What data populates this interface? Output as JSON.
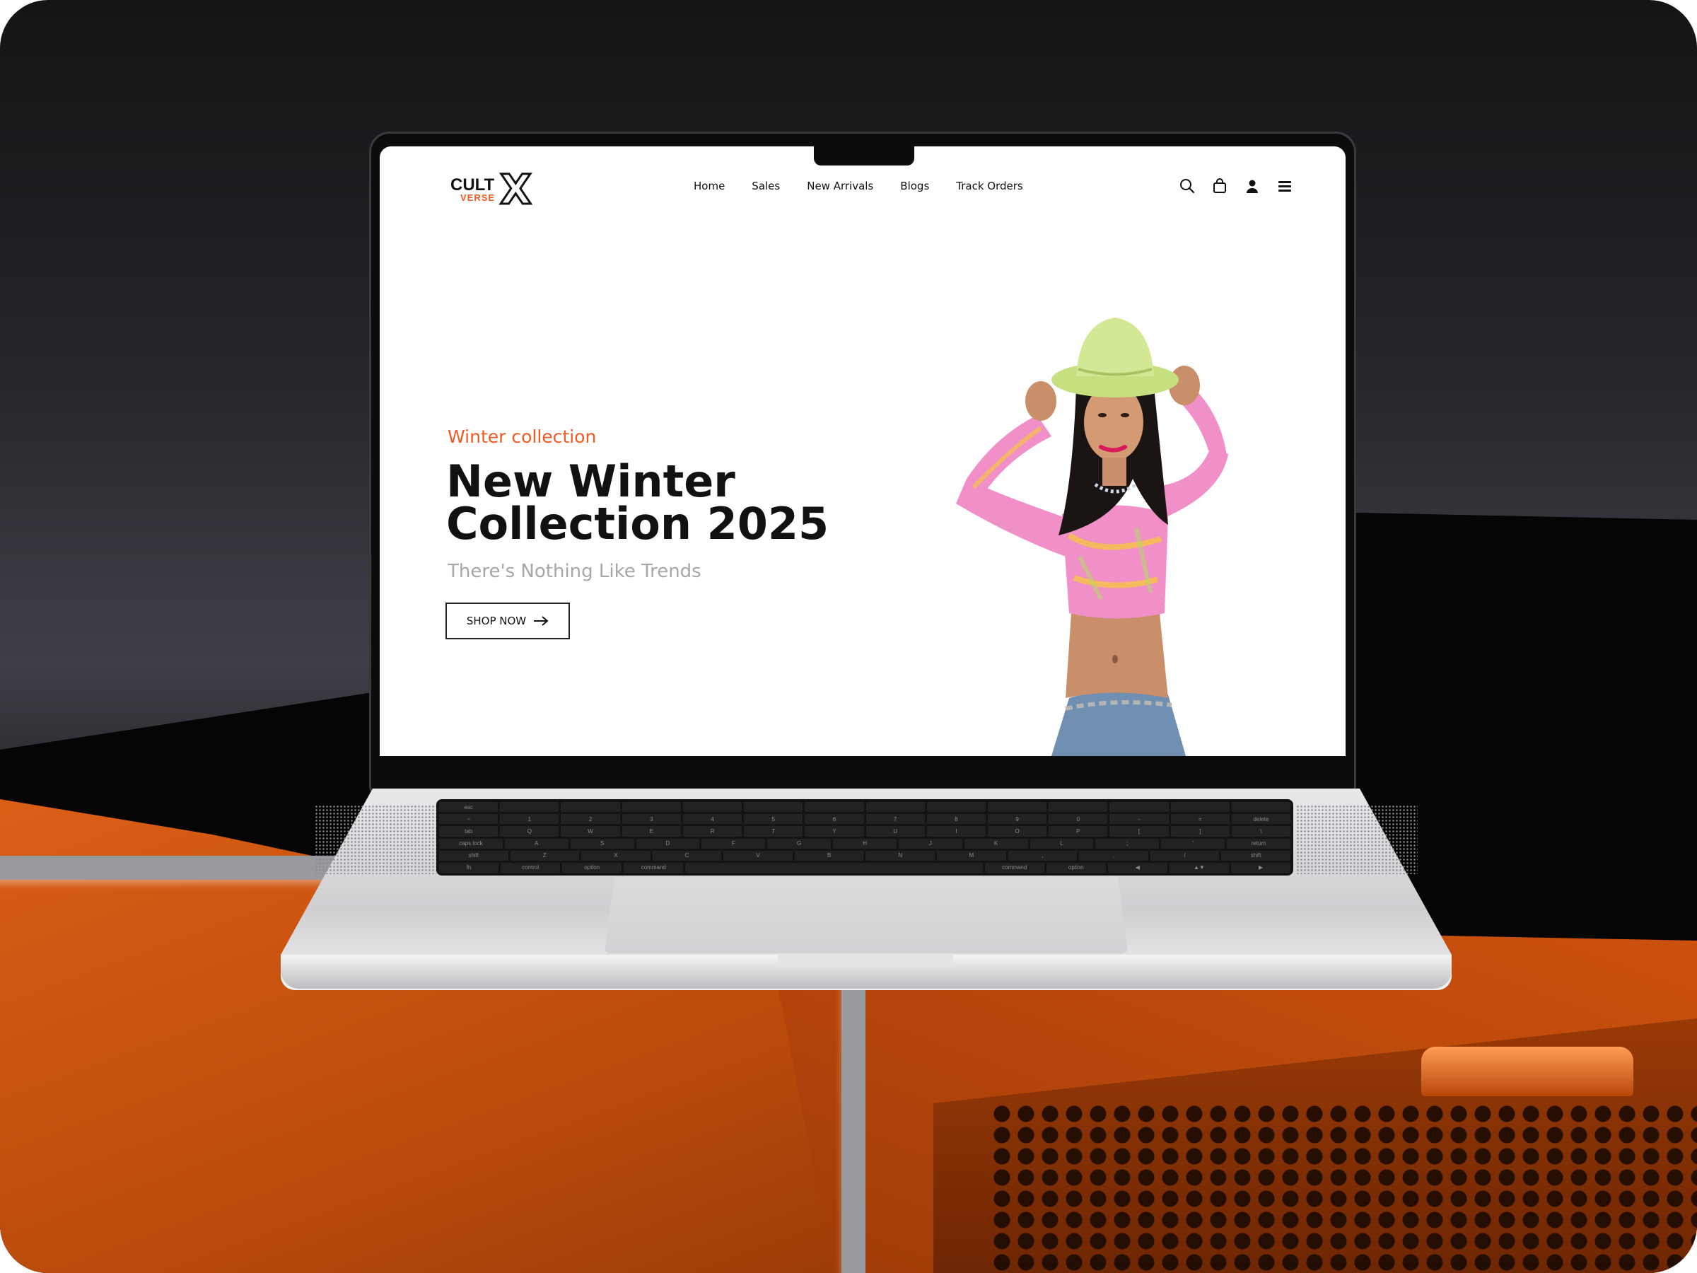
{
  "site": {
    "logo": {
      "main": "CULT",
      "sub": "VERSE",
      "mark": "X"
    },
    "nav": [
      "Home",
      "Sales",
      "New Arrivals",
      "Blogs",
      "Track Orders"
    ],
    "icons": [
      "search-icon",
      "bag-icon",
      "user-icon",
      "menu-icon"
    ]
  },
  "hero": {
    "eyebrow": "Winter collection",
    "title": "New Winter Collection 2025",
    "subtitle": "There's Nothing Like Trends",
    "cta": "SHOP NOW"
  },
  "colors": {
    "accent": "#f15a22",
    "text": "#111111",
    "muted": "#a7a7a7",
    "scene_orange": "#e56418"
  },
  "keyboard": {
    "rows": [
      [
        "esc",
        "",
        "",
        "",
        "",
        "",
        "",
        "",
        "",
        "",
        "",
        "",
        "",
        ""
      ],
      [
        "~",
        "1",
        "2",
        "3",
        "4",
        "5",
        "6",
        "7",
        "8",
        "9",
        "0",
        "-",
        "=",
        "delete"
      ],
      [
        "tab",
        "Q",
        "W",
        "E",
        "R",
        "T",
        "Y",
        "U",
        "I",
        "O",
        "P",
        "[",
        "]",
        "\\"
      ],
      [
        "caps lock",
        "A",
        "S",
        "D",
        "F",
        "G",
        "H",
        "J",
        "K",
        "L",
        ";",
        "'",
        "return"
      ],
      [
        "shift",
        "Z",
        "X",
        "C",
        "V",
        "B",
        "N",
        "M",
        ",",
        ".",
        "/",
        "shift"
      ],
      [
        "fn",
        "control",
        "option",
        "command",
        "",
        "command",
        "option",
        "◀",
        "▲▼",
        "▶"
      ]
    ]
  }
}
